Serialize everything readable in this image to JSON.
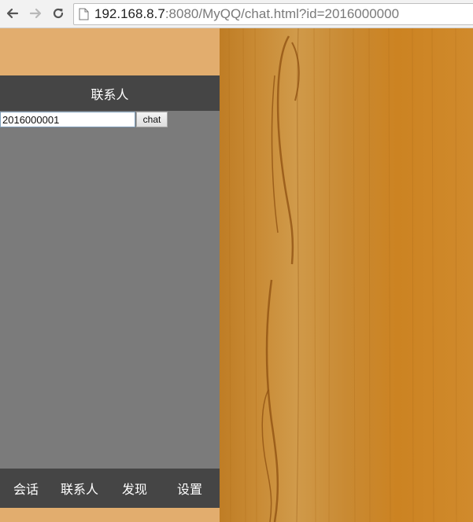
{
  "browser": {
    "url_host": "192.168.8.7",
    "url_rest": ":8080/MyQQ/chat.html?id=2016000000",
    "icons": [
      "back-arrow-icon",
      "forward-arrow-icon",
      "reload-icon",
      "page-icon"
    ]
  },
  "header": {
    "title": "联系人"
  },
  "chat": {
    "input_value": "2016000001",
    "button_label": "chat"
  },
  "bottom_nav": {
    "tabs": [
      {
        "label": "会话"
      },
      {
        "label": "联系人"
      },
      {
        "label": "发现"
      },
      {
        "label": "设置"
      }
    ]
  },
  "colors": {
    "page_background": "#e2ad6e",
    "header_background": "#454545",
    "content_background": "#7b7b7b",
    "wood_base": "#c9801f"
  }
}
